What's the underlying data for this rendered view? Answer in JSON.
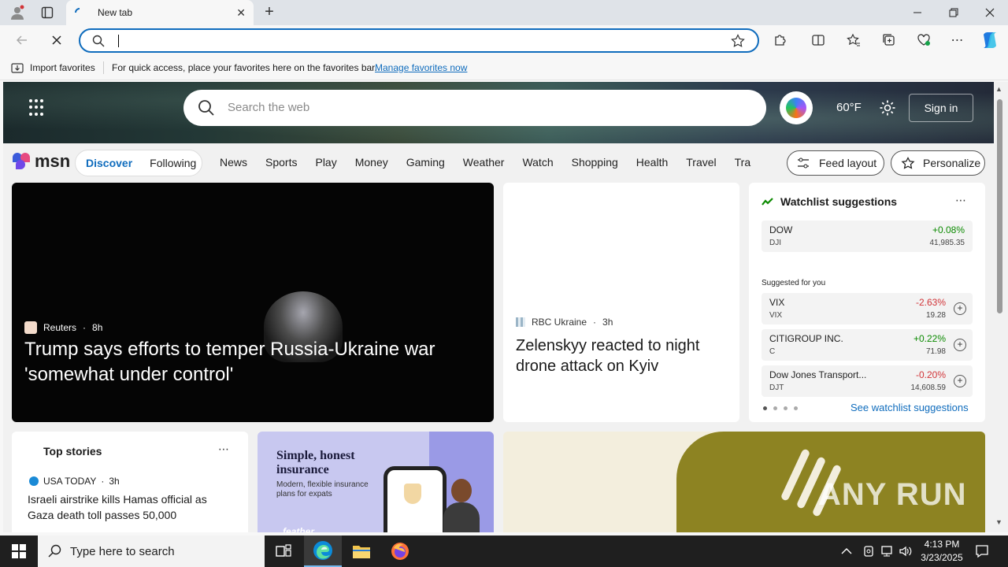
{
  "browser": {
    "tab_title": "New tab",
    "address_value": "",
    "favorites_bar": {
      "import_label": "Import favorites",
      "quick_access_text": "For quick access, place your favorites here on the favorites bar.",
      "manage_link": "Manage favorites now"
    }
  },
  "msn_header": {
    "search_placeholder": "Search the web",
    "weather": "60°F",
    "sign_in": "Sign in"
  },
  "msn_nav": {
    "logo": "msn",
    "discover": "Discover",
    "following": "Following",
    "links": [
      "News",
      "Sports",
      "Play",
      "Money",
      "Gaming",
      "Weather",
      "Watch",
      "Shopping",
      "Health",
      "Travel",
      "Tra"
    ],
    "feed_layout": "Feed layout",
    "personalize": "Personalize"
  },
  "hero": {
    "source": "Reuters",
    "age": "8h",
    "headline": "Trump says efforts to temper Russia-Ukraine war 'somewhat under control'"
  },
  "mid_story": {
    "source": "RBC Ukraine",
    "age": "3h",
    "headline": "Zelenskyy reacted to night drone attack on Kyiv"
  },
  "watchlist": {
    "title": "Watchlist suggestions",
    "main": {
      "name": "DOW",
      "ticker": "DJI",
      "change": "+0.08%",
      "price": "41,985.35"
    },
    "suggested_label": "Suggested for you",
    "suggestions": [
      {
        "name": "VIX",
        "ticker": "VIX",
        "change": "-2.63%",
        "price": "19.28",
        "direction": "down"
      },
      {
        "name": "CITIGROUP INC.",
        "ticker": "C",
        "change": "+0.22%",
        "price": "71.98",
        "direction": "up"
      },
      {
        "name": "Dow Jones Transport...",
        "ticker": "DJT",
        "change": "-0.20%",
        "price": "14,608.59",
        "direction": "down"
      }
    ],
    "see_all": "See watchlist suggestions",
    "colors": {
      "up": "#0b8a00",
      "down": "#d13438"
    }
  },
  "top_stories": {
    "title": "Top stories",
    "source": "USA TODAY",
    "age": "3h",
    "headline": "Israeli airstrike kills Hamas official as Gaza death toll passes 50,000"
  },
  "ad": {
    "headline": "Simple, honest insurance",
    "body": "Modern, flexible insurance plans for expats",
    "brand": "feather"
  },
  "watermark": "ANY RUN",
  "taskbar": {
    "search_placeholder": "Type here to search",
    "time": "4:13 PM",
    "date": "3/23/2025"
  }
}
